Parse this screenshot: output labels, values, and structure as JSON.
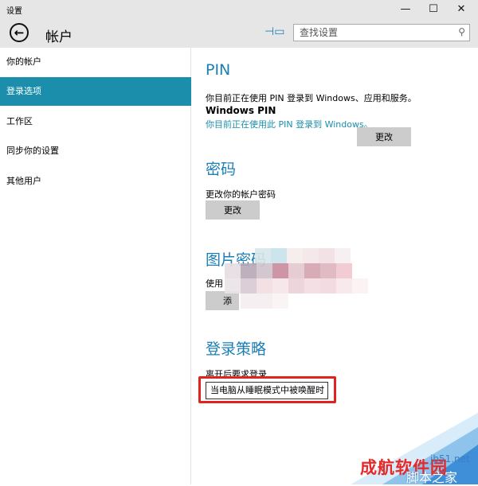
{
  "window": {
    "title": "设置",
    "minimize": "—",
    "maximize": "☐",
    "close": "✕"
  },
  "header": {
    "back_icon": "←",
    "title": "帐户",
    "pin_icon": "⊣▭",
    "search_placeholder": "查找设置",
    "search_icon": "⚲"
  },
  "sidebar": {
    "items": [
      {
        "label": "你的帐户"
      },
      {
        "label": "登录选项",
        "active": true
      },
      {
        "label": "工作区"
      },
      {
        "label": "同步你的设置"
      },
      {
        "label": "其他用户"
      }
    ]
  },
  "pin": {
    "title": "PIN",
    "description": "你目前正在使用 PIN 登录到 Windows、应用和服务。",
    "subheading": "Windows PIN",
    "status_link": "你目前正在使用此 PIN 登录到 Windows。",
    "change_button": "更改"
  },
  "password": {
    "title": "密码",
    "description": "更改你的帐户密码",
    "change_button": "更改"
  },
  "picture_password": {
    "title": "图片密码",
    "description_prefix": "使用",
    "button_prefix": "添"
  },
  "policy": {
    "title": "登录策略",
    "label": "离开后要求登录",
    "selected_option": "当电脑从睡眠模式中被唤醒时"
  },
  "watermark": {
    "brand_cn": "成航软件园",
    "brand_url": "jb51.net",
    "brand_cn2": "脚本之家"
  },
  "colors": {
    "accent": "#1b8eab",
    "title_blue": "#1b7fb5",
    "highlight_red": "#e0231f"
  }
}
